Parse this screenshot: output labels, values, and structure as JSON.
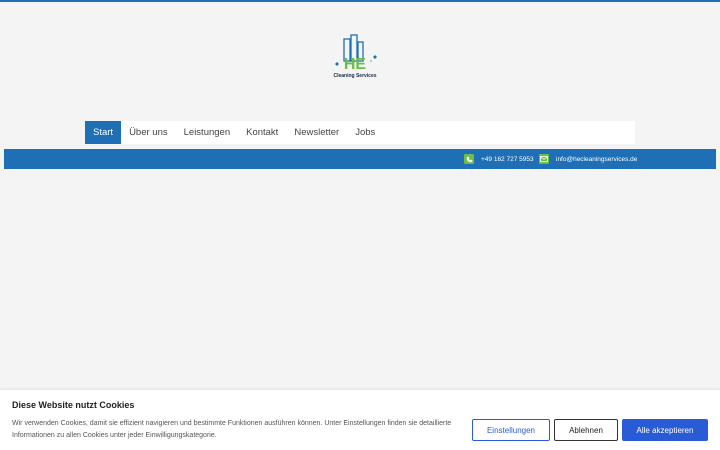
{
  "brand": {
    "logo_letters": "HE",
    "logo_text": "Cleaning Services",
    "colors": {
      "blue": "#1e6fb5",
      "green": "#6cbd45"
    }
  },
  "nav": {
    "items": [
      {
        "label": "Start",
        "active": true
      },
      {
        "label": "Über uns"
      },
      {
        "label": "Leistungen"
      },
      {
        "label": "Kontakt"
      },
      {
        "label": "Newsletter"
      },
      {
        "label": "Jobs"
      }
    ]
  },
  "contact": {
    "phone": "+49 162 727 5953",
    "phone_icon": "phone-icon",
    "email": "info@hecleaningservices.de",
    "email_icon": "mail-icon"
  },
  "cookie": {
    "title": "Diese Website nutzt Cookies",
    "text": "Wir verwenden Cookies, damit sie effizient navigieren und bestimmte Funktionen ausführen können. Unter Einstellungen finden sie detaillierte Informationen zu allen Cookies unter jeder Einwilligungskategorie.",
    "settings_label": "Einstellungen",
    "reject_label": "Ablehnen",
    "accept_label": "Alle akzeptieren",
    "accent": "#2a5bd7"
  }
}
